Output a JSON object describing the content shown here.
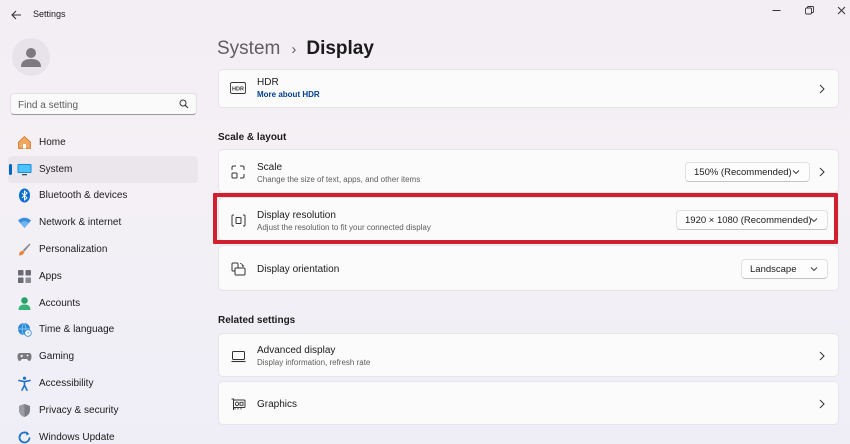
{
  "window": {
    "title": "Settings",
    "controls": {
      "minimize": "minimize-icon",
      "maximize": "maximize-icon",
      "close": "close-icon"
    }
  },
  "sidebar": {
    "search_placeholder": "Find a setting",
    "items": [
      {
        "label": "Home",
        "icon": "home-icon"
      },
      {
        "label": "System",
        "icon": "system-icon",
        "active": true
      },
      {
        "label": "Bluetooth & devices",
        "icon": "bluetooth-icon"
      },
      {
        "label": "Network & internet",
        "icon": "wifi-icon"
      },
      {
        "label": "Personalization",
        "icon": "brush-icon"
      },
      {
        "label": "Apps",
        "icon": "apps-icon"
      },
      {
        "label": "Accounts",
        "icon": "accounts-icon"
      },
      {
        "label": "Time & language",
        "icon": "globe-clock-icon"
      },
      {
        "label": "Gaming",
        "icon": "gamepad-icon"
      },
      {
        "label": "Accessibility",
        "icon": "accessibility-icon"
      },
      {
        "label": "Privacy & security",
        "icon": "shield-icon"
      },
      {
        "label": "Windows Update",
        "icon": "update-icon"
      }
    ]
  },
  "breadcrumb": {
    "parent": "System",
    "separator": "›",
    "current": "Display"
  },
  "main": {
    "hdr": {
      "title": "HDR",
      "link": "More about HDR"
    },
    "scale_layout": {
      "heading": "Scale & layout",
      "scale": {
        "title": "Scale",
        "subtitle": "Change the size of text, apps, and other items",
        "value": "150% (Recommended)"
      },
      "resolution": {
        "title": "Display resolution",
        "subtitle": "Adjust the resolution to fit your connected display",
        "value": "1920 × 1080 (Recommended)"
      },
      "orientation": {
        "title": "Display orientation",
        "value": "Landscape"
      }
    },
    "related": {
      "heading": "Related settings",
      "advanced": {
        "title": "Advanced display",
        "subtitle": "Display information, refresh rate"
      },
      "graphics": {
        "title": "Graphics"
      }
    }
  },
  "colors": {
    "accent": "#0067c0",
    "highlight": "#d0202f",
    "link": "#003e92"
  }
}
